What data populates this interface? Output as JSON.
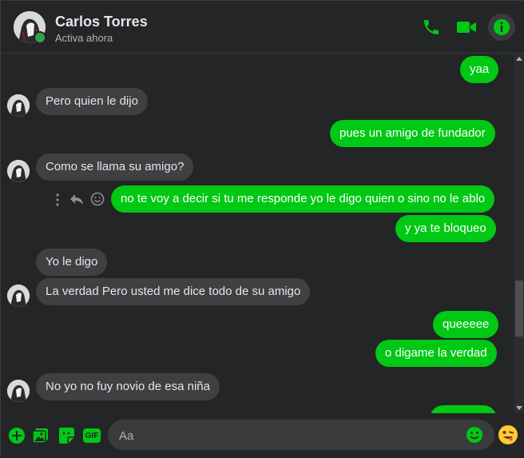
{
  "header": {
    "name": "Carlos Torres",
    "status": "Activa ahora",
    "icons": [
      "phone-icon",
      "video-camera-icon",
      "info-icon"
    ]
  },
  "messages": [
    {
      "side": "out",
      "text": "yaa"
    },
    {
      "side": "in",
      "text": "Pero quien le dijo"
    },
    {
      "side": "out",
      "text": "pues un amigo de fundador"
    },
    {
      "side": "in",
      "text": "Como se llama su amigo?"
    },
    {
      "side": "out",
      "text": "no te voy a decir si tu me responde yo le digo quien o sino no le ablo"
    },
    {
      "side": "out",
      "text": "y ya te bloqueo"
    },
    {
      "side": "in",
      "text": "Yo le digo"
    },
    {
      "side": "in",
      "text": "La verdad Pero usted me dice todo de su amigo"
    },
    {
      "side": "out",
      "text": "queeeee"
    },
    {
      "side": "out",
      "text": "o digame la verdad"
    },
    {
      "side": "in",
      "text": "No yo no fuy novio de esa niña"
    }
  ],
  "composer": {
    "placeholder": "Aa",
    "gif_label": "GIF",
    "icons": [
      "plus-icon",
      "photo-icon",
      "sticker-icon",
      "gif-icon",
      "emoji-icon",
      "reaction-emoji-icon"
    ]
  },
  "colors": {
    "accent": "#00c814",
    "background": "#242526",
    "incoming_bubble": "#3e4042"
  }
}
